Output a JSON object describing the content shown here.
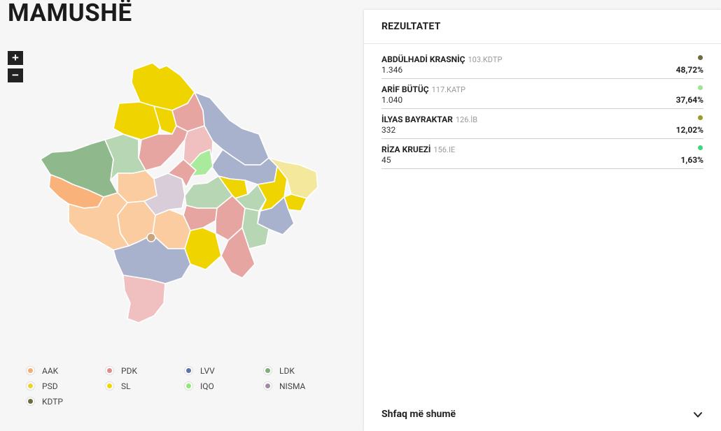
{
  "header": {
    "title": "MAMUSHË"
  },
  "zoom": {
    "in_label": "+",
    "out_label": "−"
  },
  "legend": [
    {
      "label": "AAK",
      "color": "#f6ad6e"
    },
    {
      "label": "PDK",
      "color": "#e08c8c"
    },
    {
      "label": "LVV",
      "color": "#5f73a8"
    },
    {
      "label": "LDK",
      "color": "#7fae7c"
    },
    {
      "label": "PSD",
      "color": "#ecd42a"
    },
    {
      "label": "SL",
      "color": "#f2d600"
    },
    {
      "label": "IQO",
      "color": "#8fe878"
    },
    {
      "label": "NISMA",
      "color": "#a18aa8"
    },
    {
      "label": "KDTP",
      "color": "#6c6b3a"
    }
  ],
  "results": {
    "title": "REZULTATET",
    "rows": [
      {
        "name": "ABDÜLHADİ KRASNİÇ",
        "code": "103.KDTP",
        "votes": "1.346",
        "pct": "48,72%",
        "color": "#6c6b3a"
      },
      {
        "name": "ARİF BÜTÜÇ",
        "code": "117.KATP",
        "votes": "1.040",
        "pct": "37,64%",
        "color": "#9be88f"
      },
      {
        "name": "İLYAS BAYRAKTAR",
        "code": "126.İB",
        "votes": "332",
        "pct": "12,02%",
        "color": "#9c9a2c"
      },
      {
        "name": "RİZA KRUEZİ",
        "code": "156.IE",
        "votes": "45",
        "pct": "1,63%",
        "color": "#3fd67f"
      }
    ],
    "show_more": "Shfaq më shumë"
  }
}
